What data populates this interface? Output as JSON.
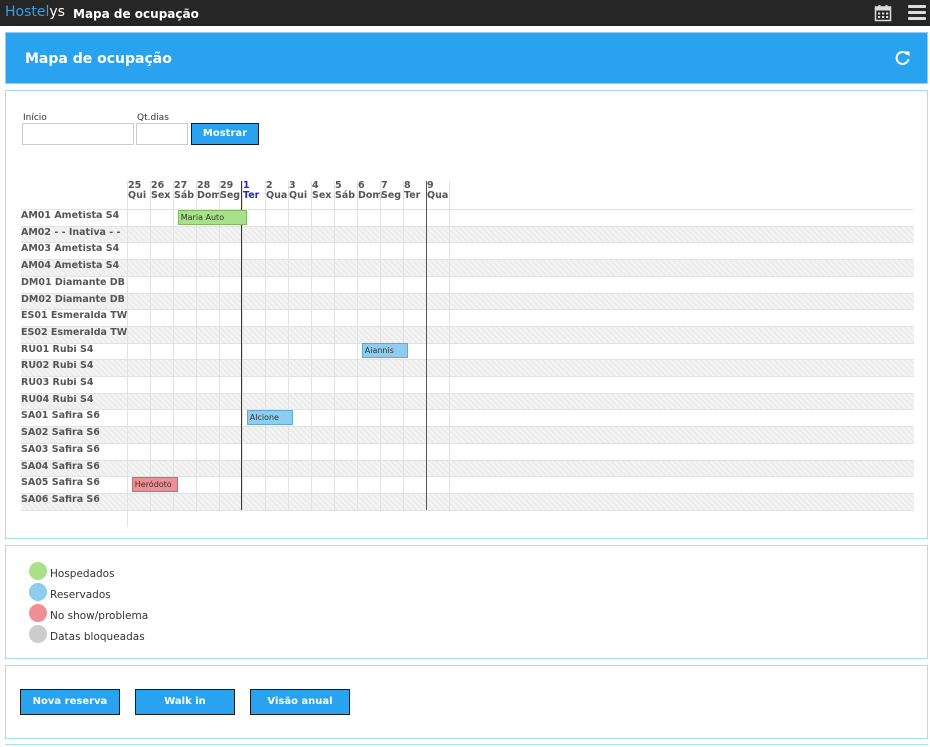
{
  "app": {
    "brand_a": "Hostel",
    "brand_b": "ys",
    "title": "Mapa de ocupação"
  },
  "header": {
    "title": "Mapa de ocupação"
  },
  "filter": {
    "inicio_label": "Início",
    "inicio_value": "",
    "qtdias_label": "Qt.dias",
    "qtdias_value": "",
    "show_label": "Mostrar"
  },
  "days": [
    {
      "num": "25",
      "dow": "Qui"
    },
    {
      "num": "26",
      "dow": "Sex"
    },
    {
      "num": "27",
      "dow": "Sáb"
    },
    {
      "num": "28",
      "dow": "Dom"
    },
    {
      "num": "29",
      "dow": "Seg"
    },
    {
      "num": "1",
      "dow": "Ter",
      "today": true
    },
    {
      "num": "2",
      "dow": "Qua"
    },
    {
      "num": "3",
      "dow": "Qui"
    },
    {
      "num": "4",
      "dow": "Sex"
    },
    {
      "num": "5",
      "dow": "Sáb"
    },
    {
      "num": "6",
      "dow": "Dom"
    },
    {
      "num": "7",
      "dow": "Seg"
    },
    {
      "num": "8",
      "dow": "Ter"
    },
    {
      "num": "9",
      "dow": "Qua"
    }
  ],
  "rooms": [
    "AM01 Ametista S4",
    "AM02 - - Inativa - -",
    "AM03 Ametista S4",
    "AM04 Ametista S4",
    "DM01 Diamante DB",
    "DM02 Diamante DB",
    "ES01 Esmeralda TW",
    "ES02 Esmeralda TW",
    "RU01 Rubi S4",
    "RU02 Rubi S4",
    "RU03 Rubi S4",
    "RU04 Rubi S4",
    "SA01 Safira S6",
    "SA02 Safira S6",
    "SA03 Safira S6",
    "SA04 Safira S6",
    "SA05 Safira S6",
    "SA06 Safira S6"
  ],
  "bookings": [
    {
      "name": "Maria Auto",
      "room": 0,
      "start": 2.25,
      "end": 5.25,
      "status": "green"
    },
    {
      "name": "Aiannis",
      "room": 8,
      "start": 10.25,
      "end": 12.25,
      "status": "blue"
    },
    {
      "name": "Alcione",
      "room": 12,
      "start": 5.25,
      "end": 7.25,
      "status": "blue"
    },
    {
      "name": "Heródoto",
      "room": 16,
      "start": 0.25,
      "end": 2.25,
      "status": "red"
    }
  ],
  "legend": [
    {
      "label": "Hospedados",
      "color": "#a9e18b"
    },
    {
      "label": "Reservados",
      "color": "#8fcdef"
    },
    {
      "label": "No show/problema",
      "color": "#ee8f96"
    },
    {
      "label": "Datas bloqueadas",
      "color": "#cccccc"
    }
  ],
  "actions": {
    "nova_reserva": "Nova reserva",
    "walk_in": "Walk in",
    "visao_anual": "Visão anual"
  },
  "colors": {
    "accent": "#29a3ef",
    "topbar": "#262626",
    "today_line": "#1a2db8"
  }
}
